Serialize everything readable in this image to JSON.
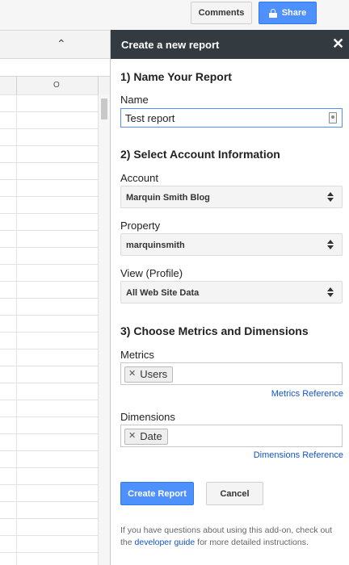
{
  "topbar": {
    "comments_label": "Comments",
    "share_label": "Share",
    "share_color": "#4d90fe"
  },
  "sheet": {
    "column_letter": "O",
    "collapse_icon": "double-chevron-up-icon"
  },
  "sidebar": {
    "title": "Create a new report",
    "close_icon": "close-icon",
    "section1": {
      "heading": "1) Name Your Report",
      "name_label": "Name",
      "name_value": "Test report"
    },
    "section2": {
      "heading": "2) Select Account Information",
      "account_label": "Account",
      "account_value": "Marquin Smith Blog",
      "property_label": "Property",
      "property_value": "marquinsmith",
      "view_label": "View (Profile)",
      "view_value": "All Web Site Data"
    },
    "section3": {
      "heading": "3) Choose Metrics and Dimensions",
      "metrics_label": "Metrics",
      "metrics": [
        "Users"
      ],
      "metrics_link": "Metrics Reference",
      "dimensions_label": "Dimensions",
      "dimensions": [
        "Date"
      ],
      "dimensions_link": "Dimensions Reference"
    },
    "buttons": {
      "create_label": "Create Report",
      "cancel_label": "Cancel"
    },
    "help": {
      "before": "If you have questions about using this add-on, check out the ",
      "link": "developer guide",
      "after": " for more detailed instructions."
    },
    "link_color": "#1155cc"
  }
}
